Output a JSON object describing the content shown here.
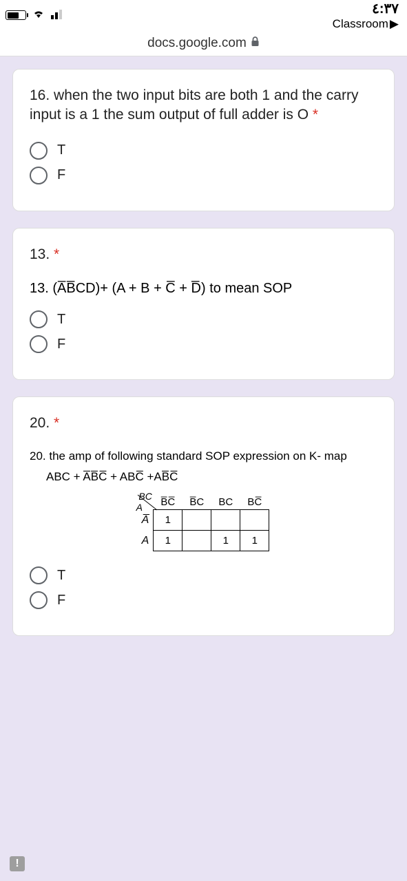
{
  "status": {
    "time": "٤:٣٧",
    "app_name": "Classroom"
  },
  "url": "docs.google.com",
  "q16": {
    "text": "16. when the two input bits are both 1 and the carry input is a 1 the sum output of full adder is O",
    "opt_t": "T",
    "opt_f": "F"
  },
  "q13": {
    "title": "13.",
    "expr_prefix": "13. (A̅B̅CD)+ (A + B + C̅ +  D̅) to mean SOP",
    "opt_t": "T",
    "opt_f": "F"
  },
  "q20": {
    "title": "20.",
    "text": "20. the amp of following standard SOP expression on K- map",
    "expr": "ABC + A̅B̅C̅ + ABC̅ +AB̅C̅",
    "kmap": {
      "corner_top": "BC",
      "corner_bottom": "A",
      "cols": [
        "B̅C̅",
        "B̅C",
        "BC",
        "BC̅"
      ],
      "rows": [
        "A̅",
        "A"
      ],
      "cells": [
        [
          "1",
          "",
          "",
          ""
        ],
        [
          "1",
          "",
          "1",
          "1"
        ]
      ]
    },
    "opt_t": "T",
    "opt_f": "F"
  },
  "error_badge": "!"
}
